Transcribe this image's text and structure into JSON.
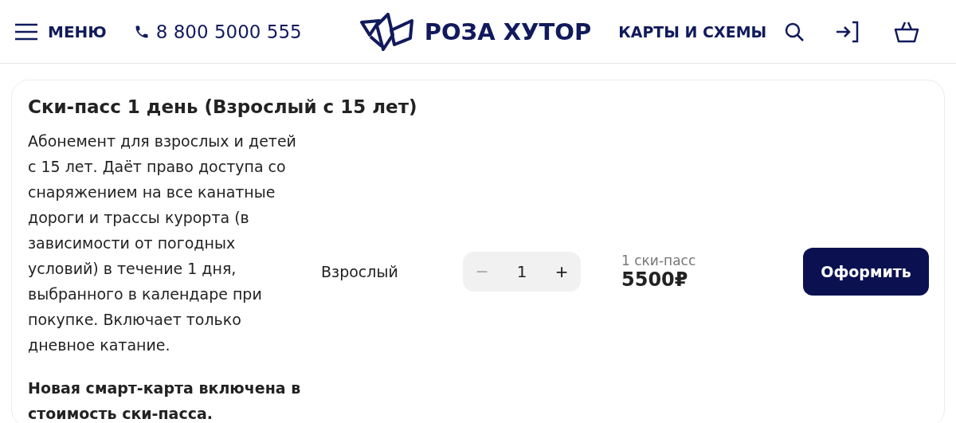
{
  "header": {
    "menu_label": "МЕНЮ",
    "phone": "8 800 5000 555",
    "logo_text": "РОЗА ХУТОР",
    "nav_link": "КАРТЫ И СХЕМЫ"
  },
  "product": {
    "title": "Ски-пасс 1 день (Взрослый с 15 лет)",
    "description": "Абонемент для взрослых и детей с 15 лет. Даёт право доступа со снаряжением на все канатные дороги и трассы курорта (в зависимости от погодных условий) в течение 1 дня, выбранного в календаре при покупке. Включает только дневное катание.",
    "note": "Новая смарт-карта включена в стоимость ски-пасса.",
    "category": "Взрослый",
    "quantity": {
      "value": "1",
      "decrement_symbol": "−",
      "increment_symbol": "+",
      "decrement_disabled": true
    },
    "price_caption": "1 ски-пасс",
    "price": "5500₽",
    "button": "Оформить"
  }
}
